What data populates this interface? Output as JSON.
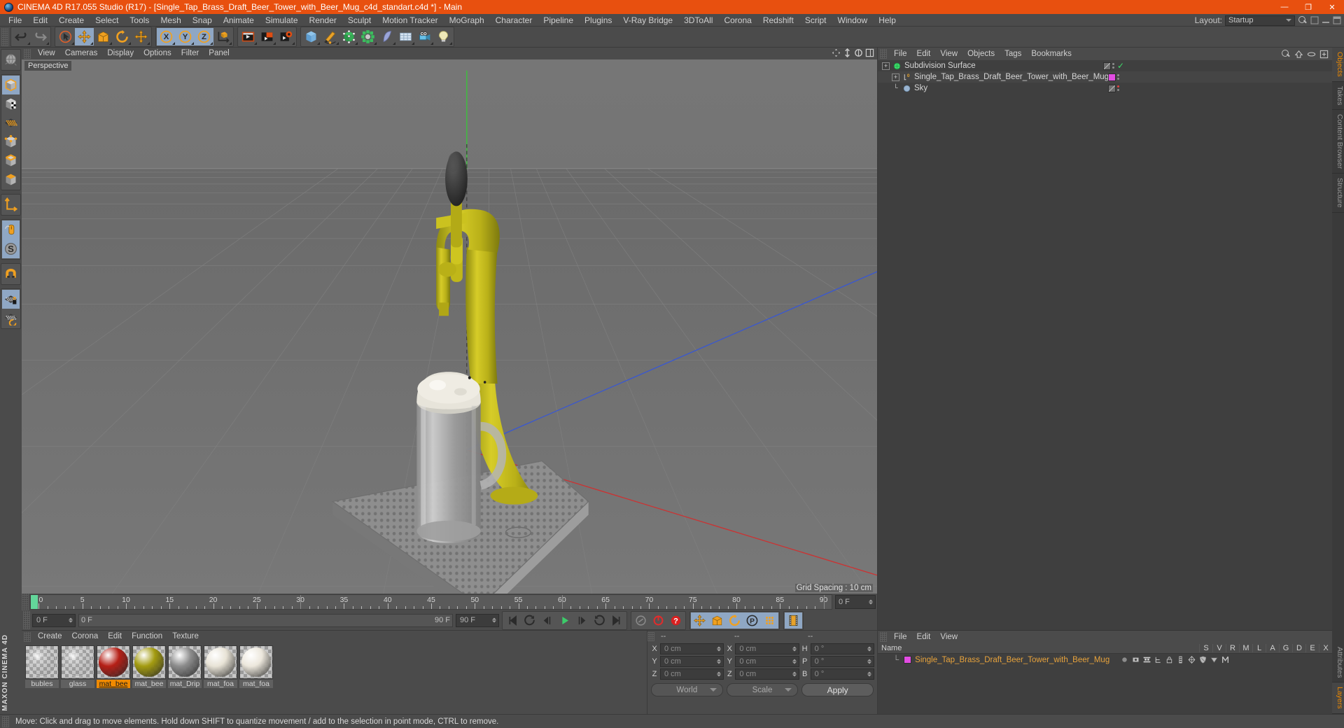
{
  "window": {
    "title": "CINEMA 4D R17.055 Studio (R17) - [Single_Tap_Brass_Draft_Beer_Tower_with_Beer_Mug_c4d_standart.c4d *] - Main",
    "minimize": "—",
    "maximize": "❐",
    "close": "✕"
  },
  "menu": {
    "items": [
      "File",
      "Edit",
      "Create",
      "Select",
      "Tools",
      "Mesh",
      "Snap",
      "Animate",
      "Simulate",
      "Render",
      "Sculpt",
      "Motion Tracker",
      "MoGraph",
      "Character",
      "Pipeline",
      "Plugins",
      "V-Ray Bridge",
      "3DToAll",
      "Corona",
      "Redshift",
      "Script",
      "Window",
      "Help"
    ],
    "layout_label": "Layout:",
    "layout_value": "Startup"
  },
  "toolbar": {
    "groups": [
      {
        "name": "undo-redo",
        "buttons": [
          {
            "name": "undo-button",
            "icon": "undo-icon",
            "selected": false
          },
          {
            "name": "redo-button",
            "icon": "redo-icon",
            "selected": false
          }
        ]
      },
      {
        "name": "transform",
        "buttons": [
          {
            "name": "live-selection-button",
            "icon": "cursor-select-icon",
            "selected": false
          },
          {
            "name": "move-button",
            "icon": "move-icon",
            "selected": true
          },
          {
            "name": "scale-button",
            "icon": "scale-icon",
            "selected": false
          },
          {
            "name": "rotate-button",
            "icon": "rotate-icon",
            "selected": false
          },
          {
            "name": "move-alt-button",
            "icon": "move-icon",
            "selected": false
          }
        ]
      },
      {
        "name": "axis-lock",
        "buttons": [
          {
            "name": "lock-x-button",
            "icon": "axis-x-icon",
            "selected": true
          },
          {
            "name": "lock-y-button",
            "icon": "axis-y-icon",
            "selected": true
          },
          {
            "name": "lock-z-button",
            "icon": "axis-z-icon",
            "selected": true
          },
          {
            "name": "world-coord-button",
            "icon": "world-axis-icon",
            "selected": false
          }
        ]
      },
      {
        "name": "render-group",
        "buttons": [
          {
            "name": "render-view-button",
            "icon": "render-view-icon",
            "selected": false
          },
          {
            "name": "render-region-button",
            "icon": "render-region-icon",
            "selected": false
          },
          {
            "name": "render-settings-button",
            "icon": "render-settings-icon",
            "selected": false
          }
        ]
      },
      {
        "name": "object-group",
        "buttons": [
          {
            "name": "primitive-cube-button",
            "icon": "cube-icon",
            "selected": false
          },
          {
            "name": "spline-pen-button",
            "icon": "pen-icon",
            "selected": false
          },
          {
            "name": "generator-button",
            "icon": "generator-icon",
            "selected": false
          },
          {
            "name": "array-button",
            "icon": "array-icon",
            "selected": false
          },
          {
            "name": "bend-deformer-button",
            "icon": "deformer-icon",
            "selected": false
          },
          {
            "name": "floor-button",
            "icon": "floor-grid-icon",
            "selected": false
          },
          {
            "name": "camera-button",
            "icon": "camera-icon",
            "selected": false
          },
          {
            "name": "light-button",
            "icon": "light-bulb-icon",
            "selected": false
          }
        ]
      }
    ]
  },
  "left_toolbar": {
    "buttons": [
      {
        "name": "viewport-display-button",
        "icon": "globe-wire-icon",
        "selected": false
      },
      {
        "name": "model-mode-button",
        "icon": "model-cube-icon",
        "selected": true
      },
      {
        "name": "texture-mode-button",
        "icon": "texture-cube-icon",
        "selected": false
      },
      {
        "name": "points-mode-button",
        "icon": "points-grid-icon",
        "selected": false
      },
      {
        "name": "point-mode-button",
        "icon": "point-cube-icon",
        "selected": false
      },
      {
        "name": "edge-mode-button",
        "icon": "edge-cube-icon",
        "selected": false
      },
      {
        "name": "polygon-mode-button",
        "icon": "polygon-cube-icon",
        "selected": false
      },
      {
        "name": "axis-modify-button",
        "icon": "axis-arrows-icon",
        "selected": false
      },
      {
        "name": "viewport-solo-button",
        "icon": "mouse-icon",
        "selected": true
      },
      {
        "name": "enable-axis-button",
        "icon": "s-circle-icon",
        "selected": true
      },
      {
        "name": "magnet-button",
        "icon": "magnet-icon",
        "selected": false
      },
      {
        "name": "lock-workplane-button",
        "icon": "grid-lock-icon",
        "selected": true
      },
      {
        "name": "workplane-rotate-button",
        "icon": "grid-rotate-icon",
        "selected": false
      }
    ],
    "brand": "MAXON CINEMA 4D"
  },
  "viewport": {
    "menu": [
      "View",
      "Cameras",
      "Display",
      "Options",
      "Filter",
      "Panel"
    ],
    "label": "Perspective",
    "grid_spacing": "Grid Spacing : 10 cm",
    "nav_icons": [
      "pan-icon",
      "zoom-icon",
      "rotate-view-icon",
      "maximize-view-icon"
    ],
    "scene": {
      "object": "Single_Tap_Brass_Draft_Beer_Tower_with_Beer_Mug",
      "tower_color": "#c8bf17",
      "handle_color": "#3a3a3a",
      "base_color": "#9a9a9a",
      "mug_foam_color": "#e4e1d6",
      "axis_x_color": "#d03030",
      "axis_y_color": "#3cc23c",
      "axis_z_color": "#3a58d0"
    }
  },
  "timeline": {
    "ticks": [
      0,
      5,
      10,
      15,
      20,
      25,
      30,
      35,
      40,
      45,
      50,
      55,
      60,
      65,
      70,
      75,
      80,
      85,
      90
    ],
    "min_frame": "0 F",
    "max_frame": "90 F",
    "current_frame": "0 F",
    "left_field": "0 F",
    "right_field": "0 F",
    "track_start": "0 F",
    "track_end": "90 F",
    "end_field": "90 F"
  },
  "playback": {
    "buttons": [
      {
        "name": "go-to-start-button",
        "icon": "skip-start-icon",
        "selected": false
      },
      {
        "name": "previous-key-button",
        "icon": "prev-key-icon",
        "selected": false
      },
      {
        "name": "step-back-button",
        "icon": "step-back-icon",
        "selected": false
      },
      {
        "name": "play-button",
        "icon": "play-icon",
        "selected": false
      },
      {
        "name": "step-forward-button",
        "icon": "step-forward-icon",
        "selected": false
      },
      {
        "name": "next-key-button",
        "icon": "next-key-icon",
        "selected": false
      },
      {
        "name": "go-to-end-button",
        "icon": "skip-end-icon",
        "selected": false
      }
    ],
    "record_group": [
      {
        "name": "autokey-button",
        "icon": "autokey-icon",
        "selected": false
      },
      {
        "name": "record-button",
        "icon": "record-icon",
        "selected": false
      },
      {
        "name": "record-question-button",
        "icon": "record-question-icon",
        "selected": false
      }
    ],
    "key_group": [
      {
        "name": "key-position-button",
        "icon": "move-icon",
        "selected": true
      },
      {
        "name": "key-scale-button",
        "icon": "scale-icon",
        "selected": true
      },
      {
        "name": "key-rotation-button",
        "icon": "rotate-icon",
        "selected": true
      },
      {
        "name": "key-parameter-button",
        "icon": "param-p-icon",
        "selected": true
      },
      {
        "name": "key-pla-button",
        "icon": "pla-dots-icon",
        "selected": true
      }
    ],
    "extra_group": [
      {
        "name": "timeline-toggle-button",
        "icon": "film-strip-icon",
        "selected": true
      }
    ]
  },
  "materials": {
    "menu": [
      "Create",
      "Corona",
      "Edit",
      "Function",
      "Texture"
    ],
    "items": [
      {
        "name": "bubles",
        "selected": false,
        "color": "#d8d8d8",
        "type": "glass"
      },
      {
        "name": "glass",
        "selected": false,
        "color": "#dedede",
        "type": "glass"
      },
      {
        "name": "mat_bee",
        "selected": true,
        "color": "#b51f16",
        "type": "solid"
      },
      {
        "name": "mat_bee",
        "selected": false,
        "color": "#a39b10",
        "type": "solid"
      },
      {
        "name": "mat_Drip",
        "selected": false,
        "color": "#8c8c8c",
        "type": "solid"
      },
      {
        "name": "mat_foa",
        "selected": false,
        "color": "#e8e3d6",
        "type": "solid"
      },
      {
        "name": "mat_foa",
        "selected": false,
        "color": "#ece7dc",
        "type": "solid"
      }
    ]
  },
  "coordinates": {
    "header": [
      "--",
      "--",
      "--"
    ],
    "rows": [
      {
        "l1": "X",
        "v1": "0 cm",
        "l2": "X",
        "v2": "0 cm",
        "l3": "H",
        "v3": "0 °"
      },
      {
        "l1": "Y",
        "v1": "0 cm",
        "l2": "Y",
        "v2": "0 cm",
        "l3": "P",
        "v3": "0 °"
      },
      {
        "l1": "Z",
        "v1": "0 cm",
        "l2": "Z",
        "v2": "0 cm",
        "l3": "B",
        "v3": "0 °"
      }
    ],
    "system": "World",
    "mode": "Scale",
    "apply": "Apply"
  },
  "object_manager": {
    "menu": [
      "File",
      "Edit",
      "View",
      "Objects",
      "Tags",
      "Bookmarks"
    ],
    "rows": [
      {
        "label": "Subdivision Surface",
        "depth": 0,
        "icon": "subdivision-surface-icon",
        "icon_color": "#3ddc6a",
        "tag_color": "",
        "check": true,
        "dot": ""
      },
      {
        "label": "Single_Tap_Brass_Draft_Beer_Tower_with_Beer_Mug",
        "depth": 1,
        "icon": "null-object-icon",
        "icon_color": "#cfcfcf",
        "tag_color": "#e24ce2",
        "check": false,
        "dot": ""
      },
      {
        "label": "Sky",
        "depth": 1,
        "icon": "sky-object-icon",
        "icon_color": "#8fa7c4",
        "tag_color": "",
        "check": false,
        "dot": "#e04040"
      }
    ]
  },
  "attribute_manager": {
    "menu": [
      "File",
      "Edit",
      "View"
    ],
    "columns": [
      "Name",
      "S",
      "V",
      "R",
      "M",
      "L",
      "A",
      "G",
      "D",
      "E",
      "X"
    ],
    "rows": [
      {
        "label": "Single_Tap_Brass_Draft_Beer_Tower_with_Beer_Mug",
        "swatch": "#e24ce2",
        "tags": [
          "sphere-dot-icon",
          "display-tag-icon",
          "render-tag-icon",
          "hierarchy-tag-icon",
          "lock-tag-icon",
          "list-tag-icon",
          "deform-tag-icon",
          "shield-tag-icon",
          "shade-tag-icon",
          "mograph-tag-icon"
        ]
      }
    ]
  },
  "right_tabs": [
    "Objects",
    "Takes",
    "Content Browser",
    "Structure"
  ],
  "right_tabs_lower": [
    "Attributes",
    "Layers"
  ],
  "statusbar": {
    "text": "Move: Click and drag to move elements. Hold down SHIFT to quantize movement / add to the selection in point mode, CTRL to remove."
  }
}
